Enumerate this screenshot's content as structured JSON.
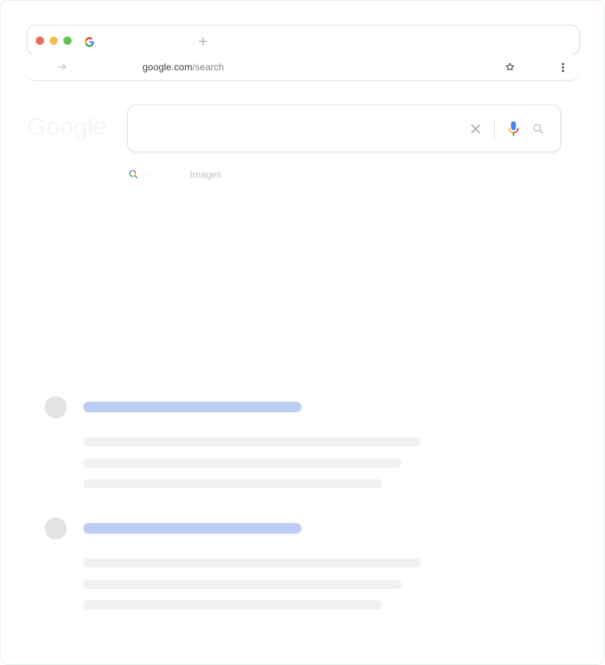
{
  "browser": {
    "tab": {
      "title": "",
      "favicon_icon": "google-g-icon",
      "new_tab_icon": "plus-icon"
    },
    "traffic_lights": {
      "close_color": "#ee6a5f",
      "minimize_color": "#f5bd4f",
      "maximize_color": "#61c454"
    },
    "address": {
      "host": "google.com",
      "path": "/search",
      "forward_icon": "arrow-right-icon",
      "bookmark_icon": "star-icon",
      "menu_icon": "kebab-menu-icon"
    }
  },
  "google": {
    "logo": "Google",
    "search": {
      "value": "",
      "placeholder": "",
      "clear_icon": "close-icon",
      "voice_icon": "microphone-icon",
      "lens_icon": "search-icon"
    },
    "tabs": [
      {
        "label": "All",
        "icon": "colored-search-icon"
      },
      {
        "label": "Images"
      },
      {
        "label": ""
      },
      {
        "label": ""
      },
      {
        "label": ""
      }
    ]
  },
  "results": {
    "count": 2,
    "skeleton_title_color": "#bccdf3",
    "skeleton_line_color": "#f1f1f1",
    "avatar_color": "#e3e3e3"
  },
  "colors": {
    "accent_blue": "#4285f4",
    "accent_red": "#ea4335",
    "accent_yellow": "#fbbc05",
    "accent_green": "#34a853"
  }
}
